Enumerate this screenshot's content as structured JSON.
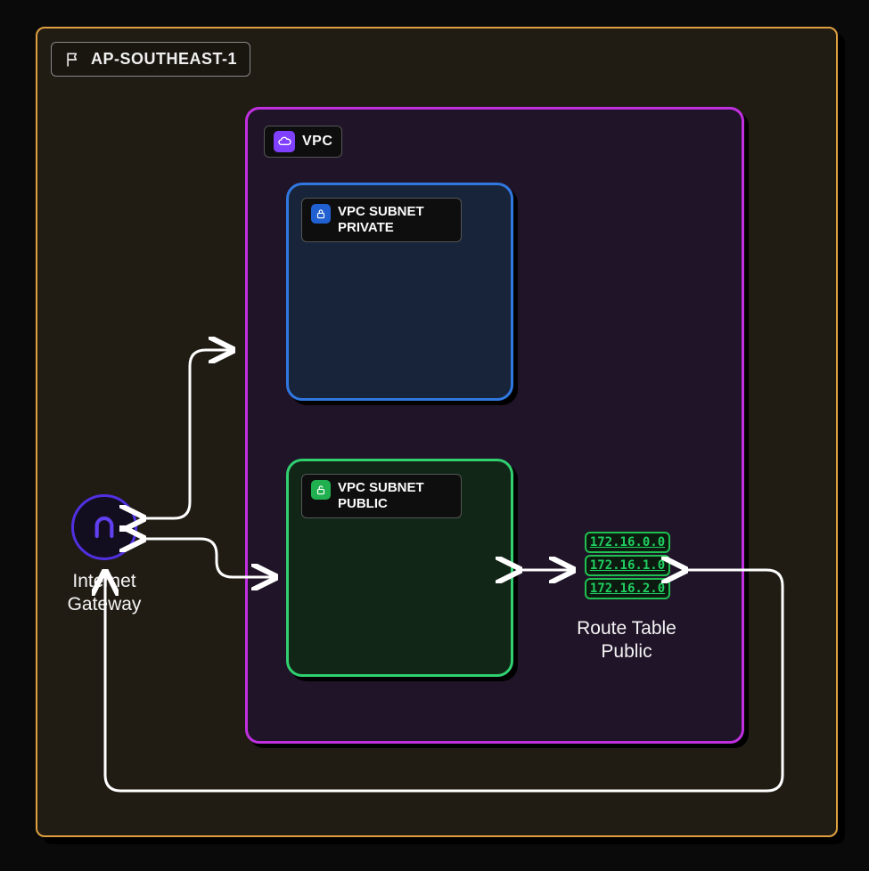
{
  "region": {
    "label": "AP-SOUTHEAST-1"
  },
  "vpc": {
    "label": "VPC",
    "subnets": {
      "private": {
        "label": "VPC SUBNET PRIVATE"
      },
      "public": {
        "label": "VPC SUBNET PUBLIC"
      }
    }
  },
  "internet_gateway": {
    "label": "Internet\nGateway"
  },
  "route_table": {
    "label": "Route Table\nPublic",
    "rows": [
      "172.16.0.0",
      "172.16.1.0",
      "172.16.2.0"
    ]
  },
  "colors": {
    "region_border": "#e0a040",
    "vpc_border": "#c030e0",
    "private_border": "#3078e0",
    "public_border": "#30d070",
    "igw_border": "#5030e0",
    "arrows": "#ffffff"
  }
}
